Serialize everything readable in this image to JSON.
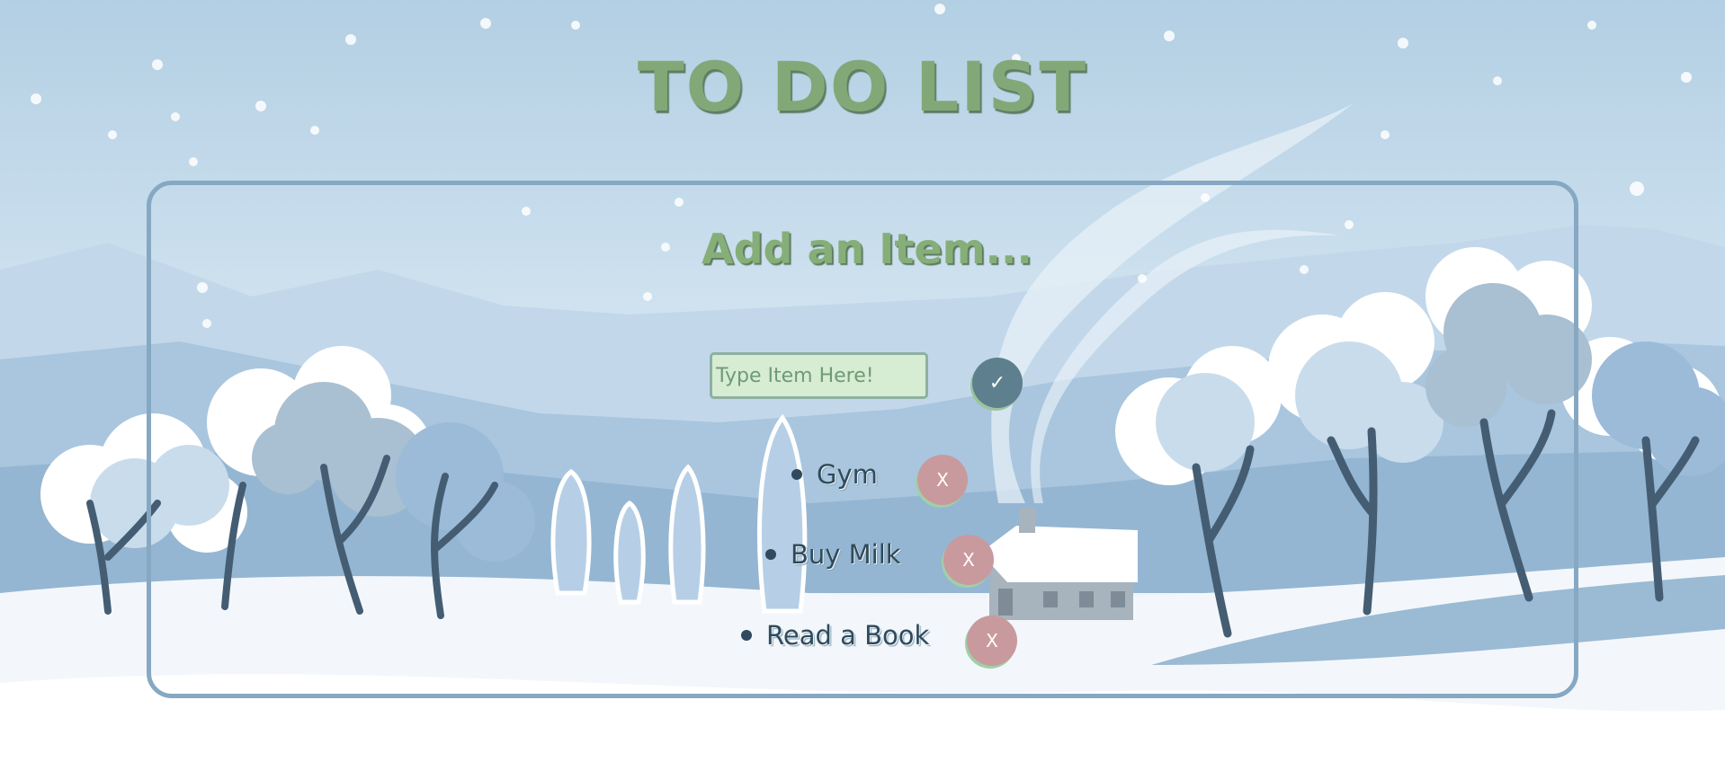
{
  "page": {
    "title": "TO DO LIST"
  },
  "form": {
    "heading": "Add an Item...",
    "input_placeholder": "Type Item Here!",
    "input_value": "",
    "submit_icon": "✓"
  },
  "items": [
    {
      "label": "Gym",
      "delete_label": "X"
    },
    {
      "label": "Buy Milk",
      "delete_label": "X"
    },
    {
      "label": "Read a Book",
      "delete_label": "X"
    }
  ],
  "colors": {
    "title": "#83a878",
    "panel_border": "#86a8c2",
    "input_bg": "#d6ecd3",
    "submit_button": "#5d7f8e",
    "delete_button": "#c89a9e",
    "item_text": "#2e4a5c"
  }
}
